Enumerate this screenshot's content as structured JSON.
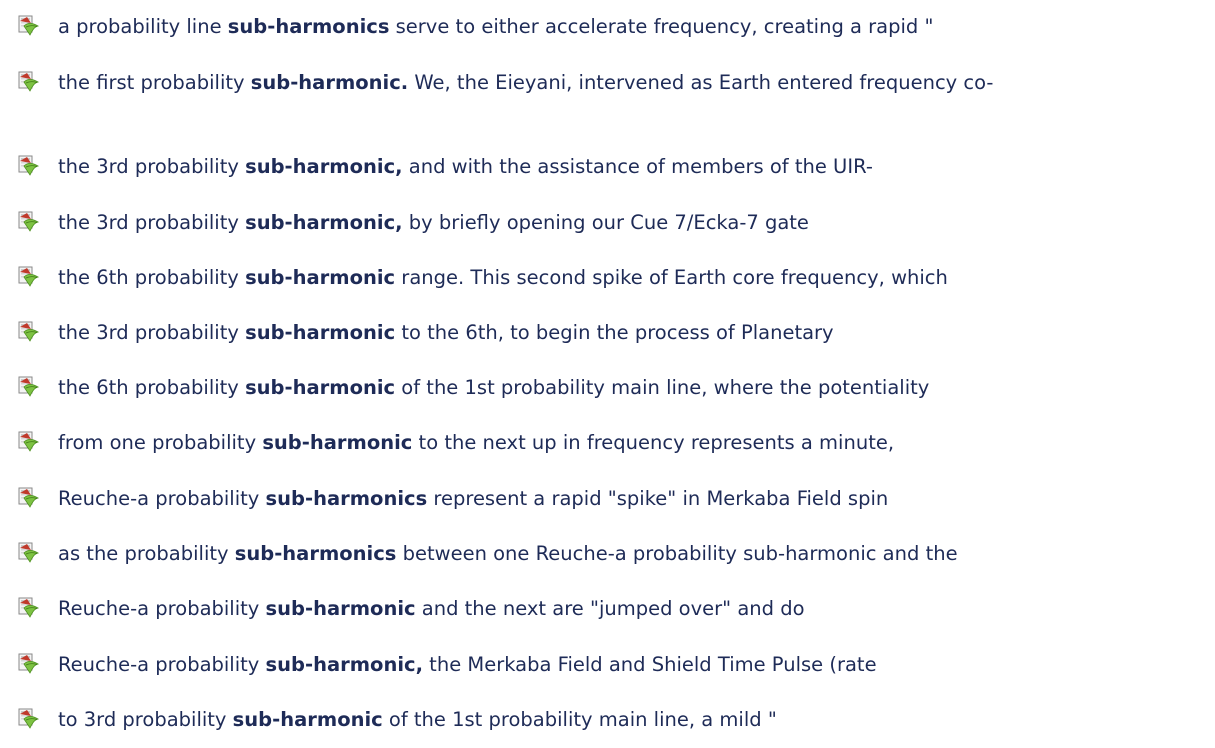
{
  "results": [
    {
      "icon": "document-icon",
      "before": "a probability line ",
      "term": "sub-harmonics",
      "after": " serve to either accelerate frequency, creating a rapid \""
    },
    {
      "icon": "document-icon",
      "before": "the first probability ",
      "term": "sub-harmonic.",
      "after": " We, the Eieyani, intervened as Earth entered frequency co-"
    },
    {
      "icon": "document-icon",
      "before": "the 3rd probability ",
      "term": "sub-harmonic,",
      "after": " and with the assistance of members of the UIR-"
    },
    {
      "icon": "document-icon",
      "before": "the 3rd probability ",
      "term": "sub-harmonic,",
      "after": " by briefly opening our Cue 7/Ecka-7 gate"
    },
    {
      "icon": "document-icon",
      "before": "the 6th probability ",
      "term": "sub-harmonic",
      "after": " range. This second spike of Earth core frequency, which"
    },
    {
      "icon": "document-icon",
      "before": "the 3rd probability ",
      "term": "sub-harmonic",
      "after": " to the 6th, to begin the process of Planetary"
    },
    {
      "icon": "document-icon",
      "before": "the 6th probability ",
      "term": "sub-harmonic",
      "after": " of the 1st probability main line, where the potentiality"
    },
    {
      "icon": "document-icon",
      "before": "from one probability ",
      "term": "sub-harmonic",
      "after": " to the next up in frequency represents a minute,"
    },
    {
      "icon": "document-icon",
      "before": "Reuche-a probability ",
      "term": "sub-harmonics",
      "after": " represent a rapid \"spike\" in Merkaba Field spin"
    },
    {
      "icon": "document-icon",
      "before": "as the probability ",
      "term": "sub-harmonics",
      "after": " between one Reuche-a probability sub-harmonic and the"
    },
    {
      "icon": "document-icon",
      "before": "Reuche-a probability ",
      "term": "sub-harmonic",
      "after": " and the next are \"jumped over\" and do"
    },
    {
      "icon": "document-icon",
      "before": "Reuche-a probability ",
      "term": "sub-harmonic,",
      "after": " the Merkaba Field and Shield Time Pulse (rate"
    },
    {
      "icon": "document-icon",
      "before": "to 3rd probability ",
      "term": "sub-harmonic",
      "after": " of the 1st probability main line, a mild \""
    }
  ]
}
